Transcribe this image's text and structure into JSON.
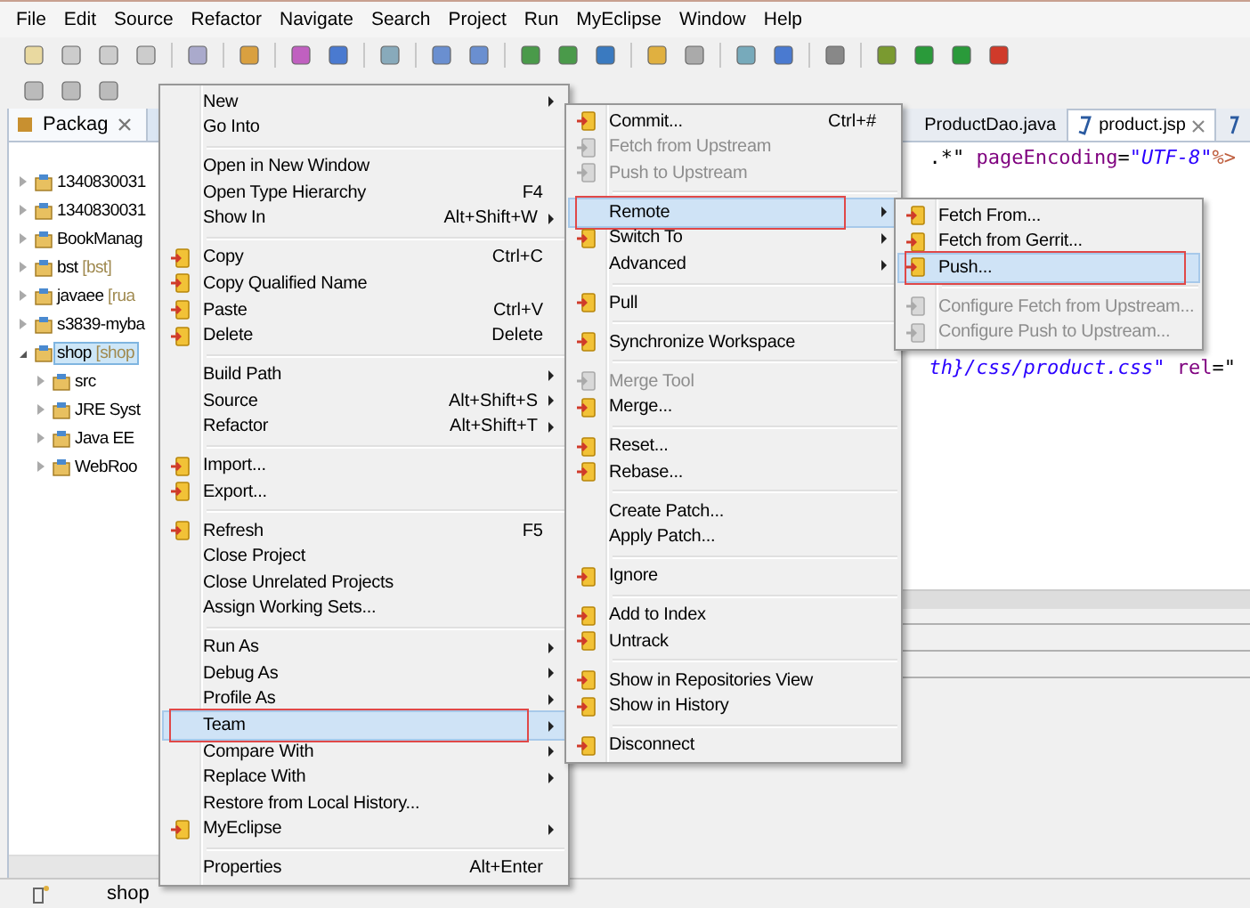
{
  "menu_bar": [
    "File",
    "Edit",
    "Source",
    "Refactor",
    "Navigate",
    "Search",
    "Project",
    "Run",
    "MyEclipse",
    "Window",
    "Help"
  ],
  "explorer": {
    "tab": {
      "label": "Packag",
      "selected": true
    },
    "tree": [
      {
        "label": "1340830031",
        "expanded": false,
        "selected": false
      },
      {
        "label": "1340830031",
        "expanded": false,
        "selected": false
      },
      {
        "label": "BookManag",
        "expanded": false,
        "selected": false
      },
      {
        "label": "bst",
        "suffix": "[bst]",
        "expanded": false,
        "selected": false
      },
      {
        "label": "javaee",
        "suffix": "[rua",
        "expanded": false,
        "selected": false
      },
      {
        "label": "s3839-myba",
        "expanded": false,
        "selected": false
      },
      {
        "label": "shop",
        "suffix": "[shop",
        "expanded": true,
        "selected": true,
        "children": [
          {
            "label": "src",
            "expanded": false,
            "selected": false
          },
          {
            "label": "JRE Syst",
            "expanded": false,
            "selected": false
          },
          {
            "label": "Java EE",
            "expanded": false,
            "selected": false
          },
          {
            "label": "WebRoo",
            "expanded": false,
            "selected": false
          }
        ]
      }
    ]
  },
  "editor": {
    "tabs": [
      {
        "label": "ProductDao.java",
        "selected": false
      },
      {
        "label": "product.jsp",
        "selected": true
      }
    ],
    "lines": [
      {
        "segments": [
          {
            "kind": "plain",
            "text": ".*\""
          },
          {
            "kind": "attr",
            "text": " pageEncoding"
          },
          {
            "kind": "plain",
            "text": "="
          },
          {
            "kind": "value",
            "text": "\"UTF-8\""
          },
          {
            "kind": "tag",
            "text": "%>"
          }
        ]
      },
      {
        "segments": [
          {
            "kind": "value",
            "text": "th}/css/product.css\""
          },
          {
            "kind": "attr",
            "text": " rel"
          },
          {
            "kind": "plain",
            "text": "=\""
          }
        ]
      }
    ]
  },
  "status_bar": {
    "project": "shop"
  },
  "context_menu": [
    {
      "kind": "item",
      "label": "New",
      "submenu": true,
      "icon": false,
      "disabled": false,
      "selected": false
    },
    {
      "kind": "item",
      "label": "Go Into",
      "submenu": false,
      "icon": false,
      "disabled": false,
      "selected": false
    },
    {
      "kind": "separator"
    },
    {
      "kind": "item",
      "label": "Open in New Window",
      "submenu": false,
      "icon": false,
      "disabled": false,
      "selected": false
    },
    {
      "kind": "item",
      "label": "Open Type Hierarchy",
      "shortcut": "F4",
      "submenu": false,
      "icon": false,
      "disabled": false,
      "selected": false
    },
    {
      "kind": "item",
      "label": "Show In",
      "shortcut": "Alt+Shift+W",
      "submenu": true,
      "icon": false,
      "disabled": false,
      "selected": false
    },
    {
      "kind": "separator"
    },
    {
      "kind": "item",
      "label": "Copy",
      "shortcut": "Ctrl+C",
      "submenu": false,
      "icon": true,
      "disabled": false,
      "selected": false
    },
    {
      "kind": "item",
      "label": "Copy Qualified Name",
      "submenu": false,
      "icon": true,
      "disabled": false,
      "selected": false
    },
    {
      "kind": "item",
      "label": "Paste",
      "shortcut": "Ctrl+V",
      "submenu": false,
      "icon": true,
      "disabled": false,
      "selected": false
    },
    {
      "kind": "item",
      "label": "Delete",
      "shortcut": "Delete",
      "submenu": false,
      "icon": true,
      "disabled": false,
      "selected": false
    },
    {
      "kind": "separator"
    },
    {
      "kind": "item",
      "label": "Build Path",
      "submenu": true,
      "icon": false,
      "disabled": false,
      "selected": false
    },
    {
      "kind": "item",
      "label": "Source",
      "shortcut": "Alt+Shift+S",
      "submenu": true,
      "icon": false,
      "disabled": false,
      "selected": false
    },
    {
      "kind": "item",
      "label": "Refactor",
      "shortcut": "Alt+Shift+T",
      "submenu": true,
      "icon": false,
      "disabled": false,
      "selected": false
    },
    {
      "kind": "separator"
    },
    {
      "kind": "item",
      "label": "Import...",
      "submenu": false,
      "icon": true,
      "disabled": false,
      "selected": false
    },
    {
      "kind": "item",
      "label": "Export...",
      "submenu": false,
      "icon": true,
      "disabled": false,
      "selected": false
    },
    {
      "kind": "separator"
    },
    {
      "kind": "item",
      "label": "Refresh",
      "shortcut": "F5",
      "submenu": false,
      "icon": true,
      "disabled": false,
      "selected": false
    },
    {
      "kind": "item",
      "label": "Close Project",
      "submenu": false,
      "icon": false,
      "disabled": false,
      "selected": false
    },
    {
      "kind": "item",
      "label": "Close Unrelated Projects",
      "submenu": false,
      "icon": false,
      "disabled": false,
      "selected": false
    },
    {
      "kind": "item",
      "label": "Assign Working Sets...",
      "submenu": false,
      "icon": false,
      "disabled": false,
      "selected": false
    },
    {
      "kind": "separator"
    },
    {
      "kind": "item",
      "label": "Run As",
      "submenu": true,
      "icon": false,
      "disabled": false,
      "selected": false
    },
    {
      "kind": "item",
      "label": "Debug As",
      "submenu": true,
      "icon": false,
      "disabled": false,
      "selected": false
    },
    {
      "kind": "item",
      "label": "Profile As",
      "submenu": true,
      "icon": false,
      "disabled": false,
      "selected": false
    },
    {
      "kind": "item",
      "label": "Team",
      "submenu": true,
      "icon": false,
      "disabled": false,
      "selected": true,
      "annotated": true
    },
    {
      "kind": "item",
      "label": "Compare With",
      "submenu": true,
      "icon": false,
      "disabled": false,
      "selected": false
    },
    {
      "kind": "item",
      "label": "Replace With",
      "submenu": true,
      "icon": false,
      "disabled": false,
      "selected": false
    },
    {
      "kind": "item",
      "label": "Restore from Local History...",
      "submenu": false,
      "icon": false,
      "disabled": false,
      "selected": false
    },
    {
      "kind": "item",
      "label": "MyEclipse",
      "submenu": true,
      "icon": true,
      "disabled": false,
      "selected": false
    },
    {
      "kind": "separator"
    },
    {
      "kind": "item",
      "label": "Properties",
      "shortcut": "Alt+Enter",
      "submenu": false,
      "icon": false,
      "disabled": false,
      "selected": false
    }
  ],
  "team_menu": [
    {
      "kind": "item",
      "label": "Commit...",
      "shortcut": "Ctrl+#",
      "submenu": false,
      "icon": true,
      "disabled": false,
      "selected": false
    },
    {
      "kind": "item",
      "label": "Fetch from Upstream",
      "submenu": false,
      "icon": true,
      "disabled": true,
      "selected": false
    },
    {
      "kind": "item",
      "label": "Push to Upstream",
      "submenu": false,
      "icon": true,
      "disabled": true,
      "selected": false
    },
    {
      "kind": "separator"
    },
    {
      "kind": "item",
      "label": "Remote",
      "submenu": true,
      "icon": false,
      "disabled": false,
      "selected": true,
      "annotated": true
    },
    {
      "kind": "item",
      "label": "Switch To",
      "submenu": true,
      "icon": true,
      "disabled": false,
      "selected": false
    },
    {
      "kind": "item",
      "label": "Advanced",
      "submenu": true,
      "icon": false,
      "disabled": false,
      "selected": false
    },
    {
      "kind": "separator"
    },
    {
      "kind": "item",
      "label": "Pull",
      "submenu": false,
      "icon": true,
      "disabled": false,
      "selected": false
    },
    {
      "kind": "separator"
    },
    {
      "kind": "item",
      "label": "Synchronize Workspace",
      "submenu": false,
      "icon": true,
      "disabled": false,
      "selected": false
    },
    {
      "kind": "separator"
    },
    {
      "kind": "item",
      "label": "Merge Tool",
      "submenu": false,
      "icon": true,
      "disabled": true,
      "selected": false
    },
    {
      "kind": "item",
      "label": "Merge...",
      "submenu": false,
      "icon": true,
      "disabled": false,
      "selected": false
    },
    {
      "kind": "separator"
    },
    {
      "kind": "item",
      "label": "Reset...",
      "submenu": false,
      "icon": true,
      "disabled": false,
      "selected": false
    },
    {
      "kind": "item",
      "label": "Rebase...",
      "submenu": false,
      "icon": true,
      "disabled": false,
      "selected": false
    },
    {
      "kind": "separator"
    },
    {
      "kind": "item",
      "label": "Create Patch...",
      "submenu": false,
      "icon": false,
      "disabled": false,
      "selected": false
    },
    {
      "kind": "item",
      "label": "Apply Patch...",
      "submenu": false,
      "icon": false,
      "disabled": false,
      "selected": false
    },
    {
      "kind": "separator"
    },
    {
      "kind": "item",
      "label": "Ignore",
      "submenu": false,
      "icon": true,
      "disabled": false,
      "selected": false
    },
    {
      "kind": "separator"
    },
    {
      "kind": "item",
      "label": "Add to Index",
      "submenu": false,
      "icon": true,
      "disabled": false,
      "selected": false
    },
    {
      "kind": "item",
      "label": "Untrack",
      "submenu": false,
      "icon": true,
      "disabled": false,
      "selected": false
    },
    {
      "kind": "separator"
    },
    {
      "kind": "item",
      "label": "Show in Repositories View",
      "submenu": false,
      "icon": true,
      "disabled": false,
      "selected": false
    },
    {
      "kind": "item",
      "label": "Show in History",
      "submenu": false,
      "icon": true,
      "disabled": false,
      "selected": false
    },
    {
      "kind": "separator"
    },
    {
      "kind": "item",
      "label": "Disconnect",
      "submenu": false,
      "icon": true,
      "disabled": false,
      "selected": false
    }
  ],
  "remote_menu": [
    {
      "kind": "item",
      "label": "Fetch From...",
      "submenu": false,
      "icon": true,
      "disabled": false,
      "selected": false
    },
    {
      "kind": "item",
      "label": "Fetch from Gerrit...",
      "submenu": false,
      "icon": true,
      "disabled": false,
      "selected": false
    },
    {
      "kind": "item",
      "label": "Push...",
      "submenu": false,
      "icon": true,
      "disabled": false,
      "selected": true,
      "annotated": true
    },
    {
      "kind": "separator"
    },
    {
      "kind": "item",
      "label": "Configure Fetch from Upstream...",
      "submenu": false,
      "icon": true,
      "disabled": true,
      "selected": false
    },
    {
      "kind": "item",
      "label": "Configure Push to Upstream...",
      "submenu": false,
      "icon": true,
      "disabled": true,
      "selected": false
    }
  ]
}
